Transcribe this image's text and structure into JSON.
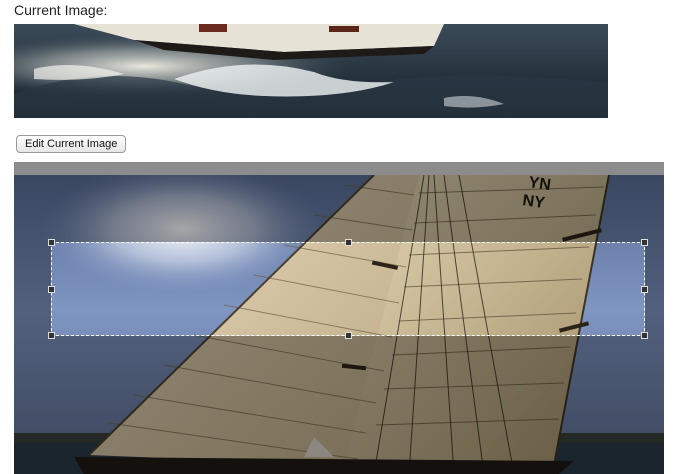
{
  "current_image": {
    "label": "Current Image:"
  },
  "edit_button": {
    "label": "Edit Current Image"
  },
  "sail": {
    "number_top": "YN",
    "number_bottom": "NY"
  },
  "colors": {
    "editor_background": "#8a8a8a",
    "sky": "#7f95c2",
    "sail": "#d9c8a3",
    "water": "#2a3a48"
  }
}
